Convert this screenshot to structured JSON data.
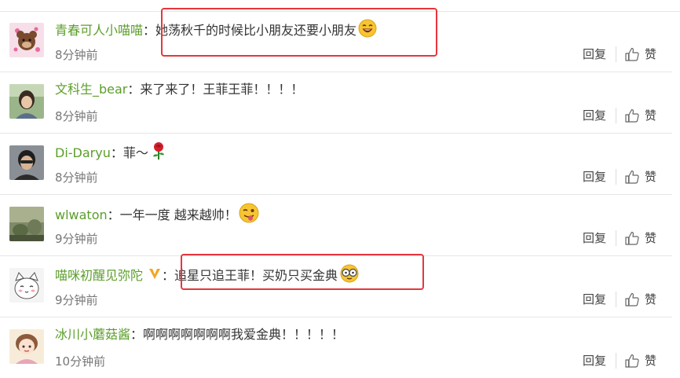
{
  "comments": [
    {
      "username": "青春可人小喵喵",
      "text": "她荡秋千的时候比小朋友还要小朋友",
      "emoji": "laughing-emoji",
      "time": "8分钟前",
      "reply": "回复",
      "like": "赞"
    },
    {
      "username": "文科生_bear",
      "text": "来了来了！王菲王菲！！！！",
      "time": "8分钟前",
      "reply": "回复",
      "like": "赞"
    },
    {
      "username": "Di-Daryu",
      "text": "菲～",
      "emoji": "rose-emoji",
      "time": "8分钟前",
      "reply": "回复",
      "like": "赞"
    },
    {
      "username": "wlwaton",
      "text": "一年一度 越来越帅！",
      "emoji": "tongue-wink-emoji",
      "time": "9分钟前",
      "reply": "回复",
      "like": "赞"
    },
    {
      "username": "喵咪初醒见弥陀",
      "badge": "V",
      "text": "追星只追王菲！买奶只买金典",
      "emoji": "glasses-emoji",
      "time": "9分钟前",
      "reply": "回复",
      "like": "赞"
    },
    {
      "username": "冰川小蘑菇酱",
      "text": "啊啊啊啊啊啊啊我爱金典！！！！！",
      "time": "10分钟前",
      "reply": "回复",
      "like": "赞"
    }
  ],
  "colors": {
    "username": "#5c9e2a",
    "highlight_box": "#e5373d",
    "vip_badge": "#f5a623"
  }
}
